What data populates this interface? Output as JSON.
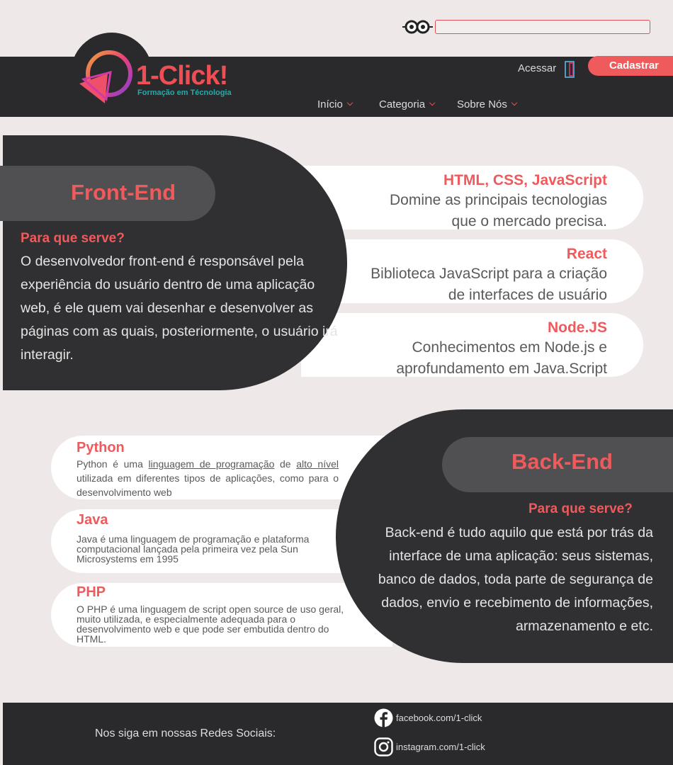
{
  "header": {
    "brand_name": "1-Click!",
    "brand_tagline": "Formação em Técnologia",
    "login_label": "Acessar",
    "signup_label": "Cadastrar",
    "nav": [
      {
        "label": "Início"
      },
      {
        "label": "Categoria"
      },
      {
        "label": "Sobre Nós"
      }
    ]
  },
  "frontend": {
    "title": "Front-End",
    "question": "Para que serve?",
    "description": "O desenvolvedor front-end é responsável pela experiência do usuário dentro de uma aplicação web, é ele quem vai desenhar e desenvolver as páginas com as quais, posteriormente, o usuário irá interagir.",
    "skills": [
      {
        "title": "HTML, CSS, JavaScript",
        "line1": "Domine as principais tecnologias",
        "line2": "que o mercado precisa."
      },
      {
        "title": "React",
        "line1": "Biblioteca JavaScript para a criação",
        "line2": "de interfaces de usuário"
      },
      {
        "title": "Node.JS",
        "line1": "Conhecimentos em Node.js e",
        "line2": "aprofundamento em Java.Script"
      }
    ]
  },
  "backend": {
    "title": "Back-End",
    "question": "Para que serve?",
    "description": "Back-end é  tudo aquilo que está por trás da interface de uma aplicação: seus sistemas, banco de dados, toda parte de segurança de dados, envio e recebimento de informações, armazenamento e etc.",
    "languages": [
      {
        "title": "Python",
        "part1": "Python é uma ",
        "link1": "linguagem de programação",
        "part2": " de ",
        "link2": "alto nível",
        "part3": " utilizada em diferentes tipos de aplicações, como para o desenvolvimento web"
      },
      {
        "title": "Java",
        "description": "Java é uma linguagem de programação e plataforma computacional lançada pela primeira vez pela Sun Microsystems em 1995"
      },
      {
        "title": "PHP",
        "description": "O PHP é uma linguagem de script open source de uso geral, muito utilizada, e especialmente adequada para o desenvolvimento web e que pode ser embutida dentro do HTML."
      }
    ]
  },
  "footer": {
    "follow_label": "Nos siga em nossas Redes Sociais:",
    "facebook": "facebook.com/1-click",
    "instagram": "instagram.com/1-click"
  },
  "colors": {
    "accent": "#ef5a5c",
    "dark": "#2a2a2c",
    "teal": "#27a9a9",
    "background": "#efe8e8"
  }
}
